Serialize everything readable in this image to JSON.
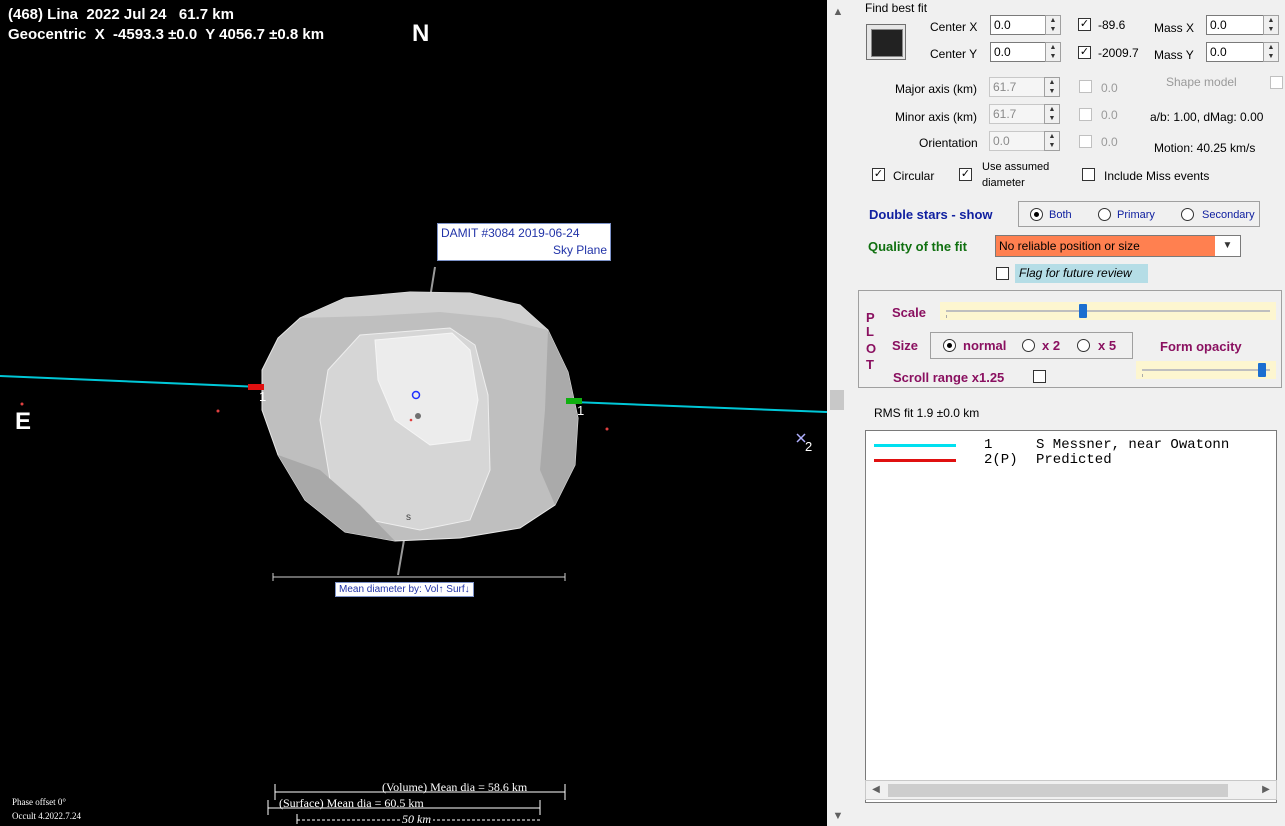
{
  "plot": {
    "header_line1": "(468) Lina  2022 Jul 24   61.7 km",
    "header_line2": "Geocentric  X  -4593.3 ±0.0  Y 4056.7 ±0.8 km",
    "north_label": "N",
    "east_label": "E",
    "damit_line1": "DAMIT #3084 2019-06-24",
    "damit_line2": "Sky Plane",
    "mean_diameter_box": "Mean diameter by:  Vol↑  Surf↓",
    "chord1_label_left": "1",
    "chord1_label_right": "1",
    "point2_label": "2",
    "south_marker": "s",
    "volume_mean_dia": "(Volume) Mean dia = 58.6 km",
    "surface_mean_dia": "(Surface) Mean dia = 60.5 km",
    "scale_bar": "50 km",
    "phase_offset": "Phase offset 0°",
    "occult_version": "Occult 4.2022.7.24",
    "colors": {
      "chord1": "#00c8d8",
      "predicted": "#e01010",
      "shape": "#b8b8b8"
    }
  },
  "panel": {
    "find_best_fit": "Find best fit",
    "center_x_label": "Center X",
    "center_x_value": "0.0",
    "center_y_label": "Center Y",
    "center_y_value": "0.0",
    "fit_x_value": "-89.6",
    "fit_y_value": "-2009.7",
    "mass_x_label": "Mass X",
    "mass_x_value": "0.0",
    "mass_y_label": "Mass Y",
    "mass_y_value": "0.0",
    "major_axis_label": "Major axis (km)",
    "major_axis_value": "61.7",
    "major_axis_fit": "0.0",
    "minor_axis_label": "Minor axis (km)",
    "minor_axis_value": "61.7",
    "minor_axis_fit": "0.0",
    "orientation_label": "Orientation",
    "orientation_value": "0.0",
    "orientation_fit": "0.0",
    "shape_model_label": "Shape model",
    "ab_dmag": "a/b: 1.00, dMag: 0.00",
    "motion": "Motion: 40.25 km/s",
    "circular_label": "Circular",
    "use_assumed_label_1": "Use assumed",
    "use_assumed_label_2": "diameter",
    "include_miss_label": "Include Miss events",
    "double_stars_label": "Double stars - show",
    "ds_both": "Both",
    "ds_primary": "Primary",
    "ds_secondary": "Secondary",
    "quality_label": "Quality of the fit",
    "quality_value": "No reliable position or size",
    "flag_review_label": "Flag for future review",
    "plot_letters": [
      "P",
      "L",
      "O",
      "T"
    ],
    "scale_label": "Scale",
    "size_label": "Size",
    "size_normal": "normal",
    "size_x2": "x 2",
    "size_x5": "x 5",
    "form_opacity_label": "Form opacity",
    "scroll_range_label": "Scroll range x1.25",
    "scale_slider_fraction": 0.42,
    "opacity_slider_fraction": 0.97,
    "rms_fit": "RMS fit 1.9 ±0.0 km",
    "list_rows": [
      {
        "id": "1",
        "text": "S Messner, near Owatonn",
        "color": "#00e0f0"
      },
      {
        "id": "2(P)",
        "text": "Predicted",
        "color": "#e01010"
      }
    ]
  }
}
